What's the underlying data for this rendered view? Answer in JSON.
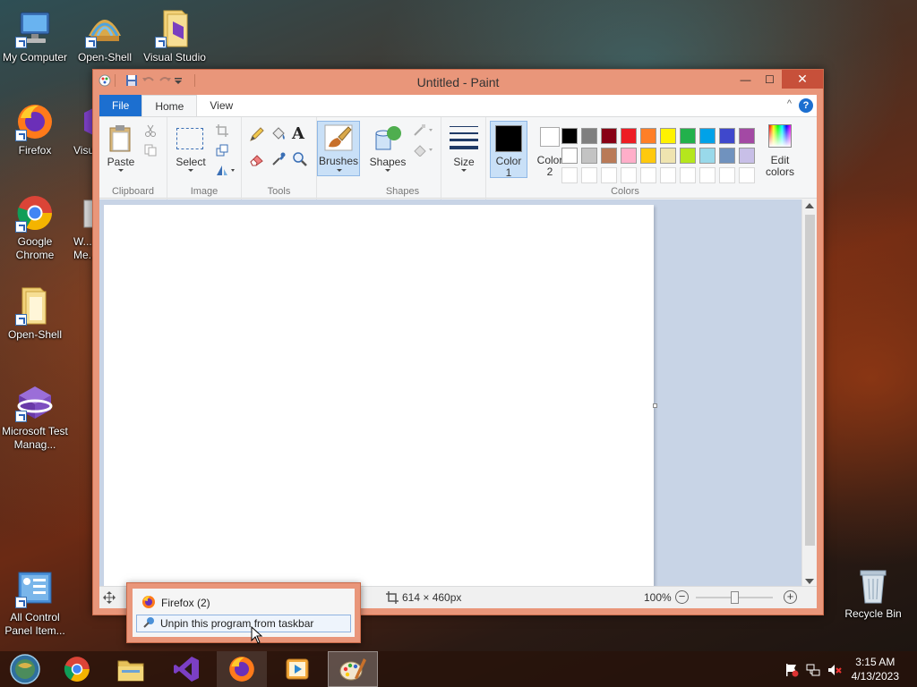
{
  "desktop": {
    "icons": [
      {
        "label": "My Computer"
      },
      {
        "label": "Open-Shell Me..."
      },
      {
        "label": "Visual Studio"
      },
      {
        "label": "Firefox"
      },
      {
        "label": "Visu..."
      },
      {
        "label": "Google Chrome"
      },
      {
        "label": "W... Me..."
      },
      {
        "label": "Open-Shell"
      },
      {
        "label": "Microsoft Test Manag..."
      },
      {
        "label": "All Control Panel Item..."
      },
      {
        "label": "Recycle Bin"
      }
    ]
  },
  "window": {
    "title": "Untitled - Paint",
    "close_glyph": "✕",
    "maximize_glyph": "☐",
    "minimize_glyph": "—"
  },
  "ribbon": {
    "tabs": [
      {
        "label": "File"
      },
      {
        "label": "Home"
      },
      {
        "label": "View"
      }
    ],
    "help_glyph": "?",
    "collapse_glyph": "^",
    "groups": {
      "clipboard": "Clipboard",
      "image": "Image",
      "tools": "Tools",
      "shapes": "Shapes",
      "colors": "Colors"
    },
    "buttons": {
      "paste": "Paste",
      "select": "Select",
      "brushes": "Brushes",
      "shapes": "Shapes",
      "size": "Size",
      "color1_line1": "Color",
      "color1_line2": "1",
      "color2_line1": "Color",
      "color2_line2": "2",
      "edit_line1": "Edit",
      "edit_line2": "colors",
      "text_tool": "A"
    },
    "palette_row1": [
      "#000000",
      "#7f7f7f",
      "#880015",
      "#ed1c24",
      "#ff7f27",
      "#fff200",
      "#22b14c",
      "#00a2e8",
      "#3f48cc",
      "#a349a4"
    ],
    "palette_row2": [
      "#ffffff",
      "#c3c3c3",
      "#b97a57",
      "#ffaec9",
      "#ffc90e",
      "#efe4b0",
      "#b5e61d",
      "#99d9ea",
      "#7092be",
      "#c8bfe7"
    ],
    "palette_row3": [
      "#ffffff",
      "#ffffff",
      "#ffffff",
      "#ffffff",
      "#ffffff",
      "#ffffff",
      "#ffffff",
      "#ffffff",
      "#ffffff",
      "#ffffff"
    ],
    "color1": "#000000",
    "color2": "#ffffff"
  },
  "statusbar": {
    "size": "614 × 460px",
    "zoom": "100%",
    "zoom_fraction": 0.5
  },
  "jumplist": {
    "header": "Firefox (2)",
    "item": "Unpin this program from taskbar"
  },
  "taskbar": {
    "time": "3:15 AM",
    "date": "4/13/2023"
  }
}
